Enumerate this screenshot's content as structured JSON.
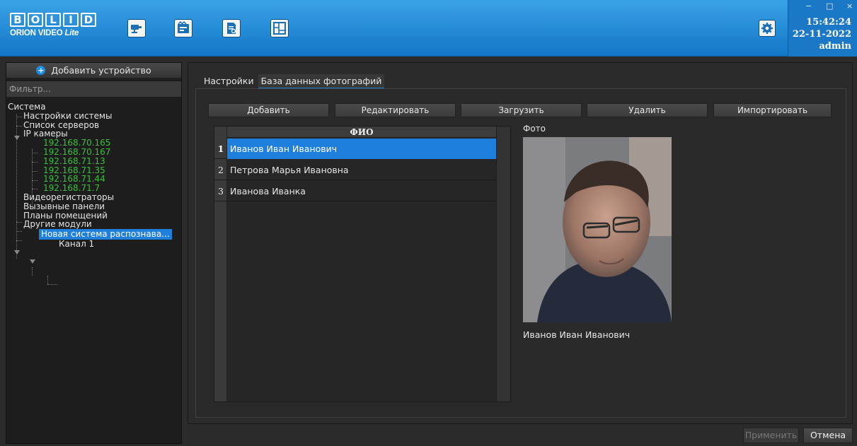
{
  "brand": {
    "logo_top": [
      "B",
      "O",
      "L",
      "I",
      "D"
    ],
    "logo_bottom_main": "ORION VIDEO ",
    "logo_bottom_italic": "Lite"
  },
  "toolbar": {
    "icons": [
      "camera-icon",
      "video-archive-icon",
      "report-icon",
      "floor-plan-icon"
    ]
  },
  "status": {
    "time": "15:42:24",
    "date": "22-11-2022",
    "user": "admin"
  },
  "window_controls": {
    "minimize": "−",
    "maximize": "□",
    "close": "×"
  },
  "sidebar": {
    "add_device_label": "Добавить устройство",
    "filter_placeholder": "Фильтр...",
    "tree": {
      "root": "Система",
      "system_settings": "Настройки системы",
      "server_list": "Список серверов",
      "ip_cameras": "IP камеры",
      "cameras": [
        "192.168.70.165",
        "192.168.70.167",
        "192.168.71.13",
        "192.168.71.35",
        "192.168.71.44",
        "192.168.71.7"
      ],
      "video_recorders": "Видеорегистраторы",
      "call_panels": "Вызывные панели",
      "room_plans": "Планы помещений",
      "other_modules": "Другие модули",
      "recognition_system": "Новая система распознава...",
      "channel": "Канал 1"
    }
  },
  "main": {
    "tabs": [
      {
        "label": "Настройки",
        "active": false
      },
      {
        "label": "База данных фотографий",
        "active": true
      }
    ],
    "buttons": {
      "add": "Добавить",
      "edit": "Редактировать",
      "upload": "Загрузить",
      "delete": "Удалить",
      "import": "Импортировать"
    },
    "table": {
      "header": "ФИО",
      "rows": [
        {
          "num": "1",
          "name": "Иванов Иван Иванович",
          "selected": true
        },
        {
          "num": "2",
          "name": "Петрова Марья Ивановна",
          "selected": false
        },
        {
          "num": "3",
          "name": "Иванова Иванка",
          "selected": false
        }
      ]
    },
    "photo": {
      "label": "Фото",
      "caption": "Иванов Иван Иванович"
    }
  },
  "footer": {
    "apply": "Применить",
    "cancel": "Отмена"
  },
  "colors": {
    "accent": "#1f7fdc",
    "header_blue": "#1a78c6",
    "camera_green": "#39c13b"
  }
}
